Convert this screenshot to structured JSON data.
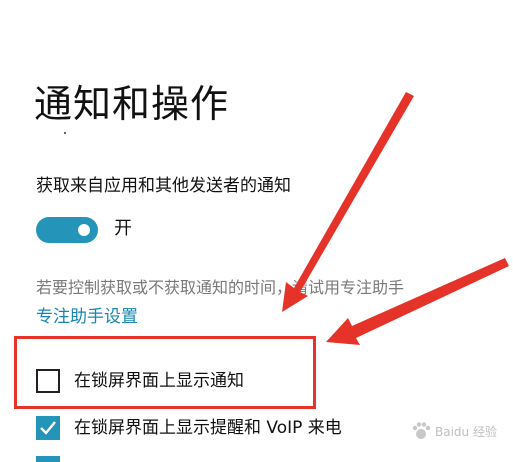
{
  "page": {
    "title": "通知和操作"
  },
  "notifications": {
    "section_label": "获取来自应用和其他发送者的通知",
    "toggle_state_label": "开",
    "toggle_on": true,
    "hint_text": "若要控制获取或不获取通知的时间，请试用专注助手",
    "focus_assist_link": "专注助手设置"
  },
  "options": [
    {
      "label": "在锁屏界面上显示通知",
      "checked": false
    },
    {
      "label": "在锁屏界面上显示提醒和 VoIP 来电",
      "checked": true
    }
  ],
  "annotation": {
    "highlight_color": "#e5332a",
    "arrow_color": "#e5332a"
  },
  "colors": {
    "accent": "#2494b8",
    "link": "#1a86b0",
    "hint": "#7a7a7a"
  },
  "watermark": {
    "text": "Baidu 经验"
  }
}
